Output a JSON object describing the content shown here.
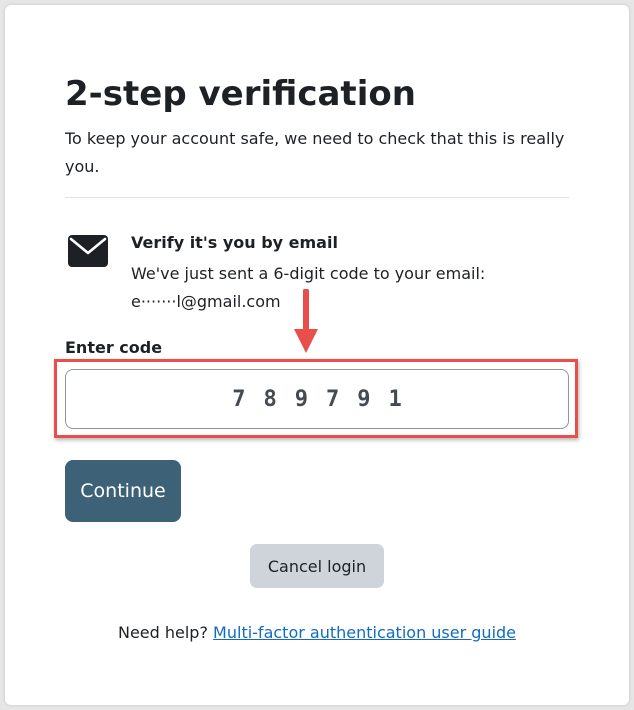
{
  "page": {
    "title": "2-step verification",
    "subtitle": "To keep your account safe, we need to check that this is really you."
  },
  "verify": {
    "heading": "Verify it's you by email",
    "message": "We've just sent a 6-digit code to your email:",
    "masked_email": "e·······l@gmail.com",
    "icon": "envelope-icon"
  },
  "form": {
    "code_label": "Enter code",
    "code_value": "789791",
    "continue_label": "Continue",
    "cancel_label": "Cancel login"
  },
  "help": {
    "prefix": "Need help?",
    "link_text": "Multi-factor authentication user guide"
  },
  "annotation": {
    "icon": "arrow-down-icon",
    "color": "#e94e4b"
  },
  "colors": {
    "primary_button": "#3d6277",
    "secondary_button": "#ced4da",
    "link": "#0f6cbf"
  }
}
